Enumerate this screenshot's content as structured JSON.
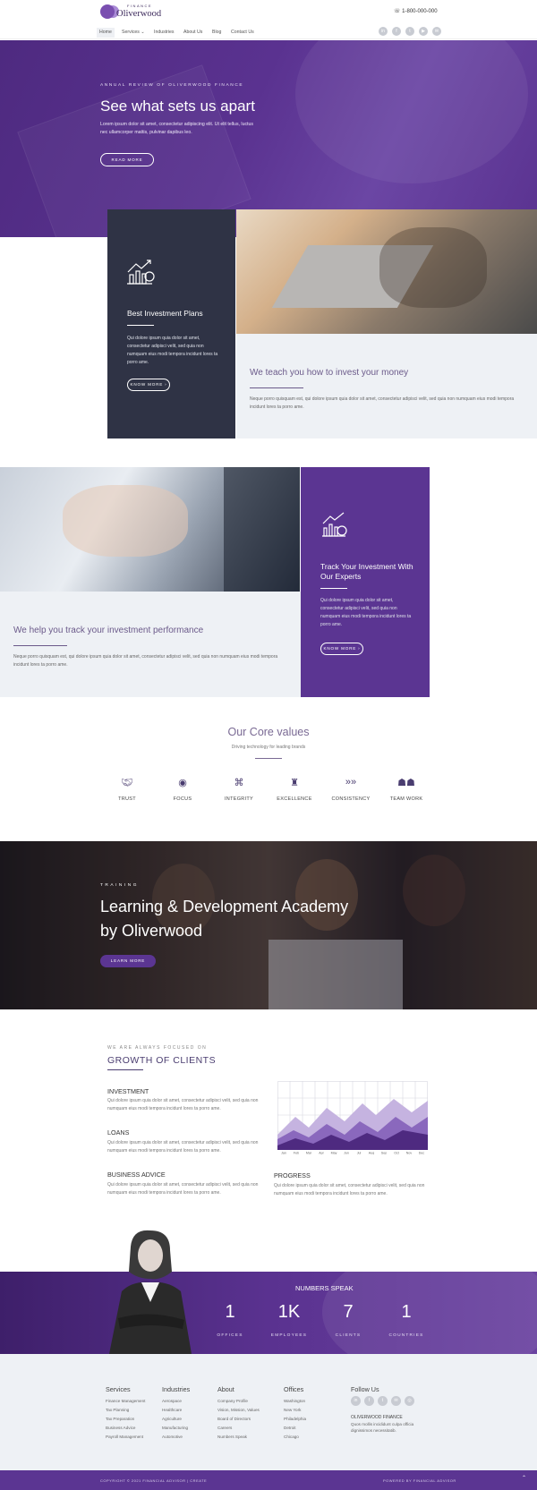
{
  "header": {
    "logo_tag": "FINANCE",
    "logo_word": "Oliverwood",
    "phone": "1-800-000-000",
    "nav": [
      "Home",
      "Services",
      "Industries",
      "About Us",
      "Blog",
      "Contact Us"
    ],
    "social_icons": [
      "linkedin-icon",
      "facebook-icon",
      "twitter-icon",
      "youtube-icon",
      "email-icon"
    ]
  },
  "hero": {
    "kicker": "ANNUAL REVIEW OF OLIVERWOOD FINANCE",
    "title": "See what sets us apart",
    "text": "Lorem ipsum dolor sit amet, consectetur adipiscing elit. Ut elit tellus, luctus nec ullamcorper mattis, pulvinar dapibus leo.",
    "button": "READ MORE"
  },
  "plans": {
    "card_title": "Best Investment Plans",
    "card_text": "Qui dolore ipsum quia dolor sit amet, consectetur adipisci velit, sed quia non numquam eius modi tempora incidunt lores ta porro ame.",
    "card_button": "KNOW MORE",
    "panel_title": "We teach you how to invest your money",
    "panel_text": "Neque porro quisquam est, qui dolore ipsum quia dolor sit amet, consectetur adipisci velit, sed quia non numquam eius modi tempora incidunt lores ta porro ame."
  },
  "track": {
    "panel_title": "We help you track your investment performance",
    "panel_text": "Neque porro quisquam est, qui dolore ipsum quia dolor sit amet, consectetur adipisci velit, sed quia non numquam eius modi tempora incidunt lores ta porro ame.",
    "card_title": "Track Your Investment With Our Experts",
    "card_text": "Qui dolore ipsum quia dolor sit amet, consectetur adipisci velit, sed quia non numquam eius modi tempora incidunt lores ta porro ame.",
    "card_button": "KNOW MORE"
  },
  "core_values": {
    "title": "Our Core values",
    "subtitle": "Driving technology for leading brands",
    "items": [
      {
        "label": "TRUST",
        "icon": "handshake-icon"
      },
      {
        "label": "FOCUS",
        "icon": "eye-icon"
      },
      {
        "label": "INTEGRITY",
        "icon": "network-icon"
      },
      {
        "label": "EXCELLENCE",
        "icon": "trophy-icon"
      },
      {
        "label": "CONSISTENCY",
        "icon": "chevrons-icon"
      },
      {
        "label": "TEAM WORK",
        "icon": "team-icon"
      }
    ]
  },
  "academy": {
    "kicker": "TRAINING",
    "title": "Learning & Development Academy by Oliverwood",
    "button": "LEARN MORE"
  },
  "growth": {
    "kicker": "WE ARE ALWAYS FOCUSED ON",
    "title": "GROWTH OF CLIENTS",
    "items": [
      {
        "title": "INVESTMENT",
        "text": "Qui dolore ipsum quia dolor sit amet, consectetur adipisci velit, sed quia non numquam eius modi tempora incidunt lores ta porro ame."
      },
      {
        "title": "LOANS",
        "text": "Qui dolore ipsum quia dolor sit amet, consectetur adipisci velit, sed quia non numquam eius modi tempora incidunt lores ta porro ame."
      },
      {
        "title": "BUSINESS ADVICE",
        "text": "Qui dolore ipsum quia dolor sit amet, consectetur adipisci velit, sed quia non numquam eius modi tempora incidunt lores ta porro ame."
      }
    ],
    "progress_title": "PROGRESS",
    "progress_text": "Qui dolore ipsum quia dolor sit amet, consectetur adipisci velit, sed quia non numquam eius modi tempora incidunt lores ta porro ame.",
    "chart_months": [
      "Jan",
      "Feb",
      "Mar",
      "Apr",
      "May",
      "Jun",
      "Jul",
      "Aug",
      "Sep",
      "Oct",
      "Nov",
      "Dec"
    ]
  },
  "numbers": {
    "title": "NUMBERS SPEAK",
    "stats": [
      {
        "value": "1",
        "label": "OFFICES"
      },
      {
        "value": "1K",
        "label": "EMPLOYEES"
      },
      {
        "value": "7",
        "label": "CLIENTS"
      },
      {
        "value": "1",
        "label": "COUNTRIES"
      }
    ]
  },
  "footer": {
    "columns": [
      {
        "title": "Services",
        "links": [
          "Finance Management",
          "Tax Planning",
          "Tax Preparation",
          "Business Advice",
          "Payroll Management"
        ]
      },
      {
        "title": "Industries",
        "links": [
          "Aerospace",
          "Healthcare",
          "Agriculture",
          "Manufacturing",
          "Automotive"
        ]
      },
      {
        "title": "About",
        "links": [
          "Company Profile",
          "Vision, Mission, Values",
          "Board of Directors",
          "Careers",
          "Numbers Speak"
        ]
      },
      {
        "title": "Offices",
        "links": [
          "Washington",
          "New York",
          "Philadelphia",
          "Detroit",
          "Chicago"
        ]
      }
    ],
    "follow_title": "Follow Us",
    "company": "OLIVERWOOD FINANCE",
    "company_text": "Quos mollis incididunt culpa officia dignissimos necessitatib.",
    "copyright": "COPYRIGHT © 2021 FINANCIAL ADVISOR | CREATE",
    "powered": "POWERED BY FINANCIAL ADVISOR"
  },
  "colors": {
    "brand": "#5b3592",
    "dark": "#2f3345",
    "light": "#eef1f5"
  }
}
